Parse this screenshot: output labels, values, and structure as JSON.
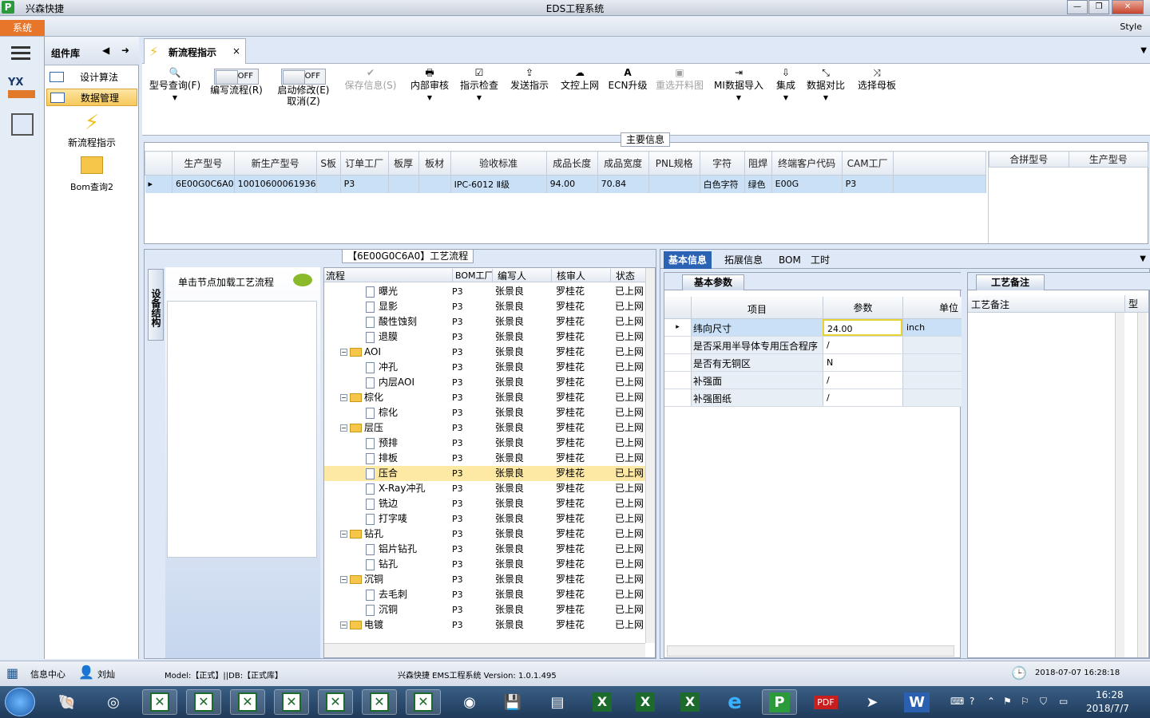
{
  "window": {
    "app_name": "兴森快捷",
    "title": "EDS工程系统",
    "style_label": "Style",
    "system_button": "系统"
  },
  "side_panel": {
    "header": "组件库",
    "items": [
      {
        "label": "设计算法",
        "selected": false
      },
      {
        "label": "数据管理",
        "selected": true
      }
    ],
    "launchers": [
      {
        "label": "新流程指示",
        "icon": "lightning-icon"
      },
      {
        "label": "Bom查询2",
        "icon": "folder-open-icon"
      }
    ]
  },
  "doc_tab": {
    "label": "新流程指示",
    "close": "×"
  },
  "toolbar": {
    "buttons": [
      {
        "label": "型号查询(F)",
        "icon": "search-icon",
        "enabled": true,
        "dropdown": true
      },
      {
        "label": "编写流程(R)",
        "toggle": "OFF",
        "enabled": true
      },
      {
        "label": "启动修改(E)",
        "label2": "取消(Z)",
        "toggle": "OFF",
        "enabled": true
      },
      {
        "label": "保存信息(S)",
        "icon": "check-icon",
        "enabled": false
      },
      {
        "label": "内部审核",
        "icon": "printer-icon",
        "enabled": true,
        "dropdown": true
      },
      {
        "label": "指示检查",
        "icon": "checkbox-icon",
        "enabled": true,
        "dropdown": true
      },
      {
        "label": "发送指示",
        "icon": "upload-icon",
        "enabled": true
      },
      {
        "label": "文控上网",
        "icon": "cloud-upload-icon",
        "enabled": true
      },
      {
        "label": "ECN升级",
        "icon": "text-a-icon",
        "enabled": true
      },
      {
        "label": "重选开料图",
        "icon": "image-icon",
        "enabled": false
      },
      {
        "label": "MI数据导入",
        "icon": "import-icon",
        "enabled": true,
        "dropdown": true
      },
      {
        "label": "集成",
        "icon": "download-icon",
        "enabled": true,
        "dropdown": true
      },
      {
        "label": "数据对比",
        "icon": "compare-icon",
        "enabled": true,
        "dropdown": true
      },
      {
        "label": "选择母板",
        "icon": "shuffle-icon",
        "enabled": true
      }
    ]
  },
  "main_info": {
    "title": "主要信息",
    "columns": [
      "生产型号",
      "新生产型号",
      "S板",
      "订单工厂",
      "板厚",
      "板材",
      "验收标准",
      "成品长度",
      "成品宽度",
      "PNL规格",
      "字符",
      "阻焊",
      "终端客户代码",
      "CAM工厂"
    ],
    "row": [
      "6E00G0C6A0",
      "10010600061936",
      "",
      "P3",
      "",
      "",
      "IPC-6012 Ⅱ级",
      "94.00",
      "70.84",
      "",
      "白色字符",
      "绿色",
      "E00G",
      "P3"
    ],
    "side_columns": [
      "合拼型号",
      "生产型号"
    ]
  },
  "process_flow": {
    "title": "【6E00G0C6A0】工艺流程",
    "left_tab": "设备结构",
    "hint": "单击节点加载工艺流程",
    "columns": [
      "流程",
      "BOM工厂",
      "编写人",
      "核审人",
      "状态"
    ],
    "rows": [
      {
        "label": "曝光",
        "level": 2,
        "type": "doc",
        "bom": "P3",
        "writer": "张景良",
        "reviewer": "罗桂花",
        "status": "已上网"
      },
      {
        "label": "显影",
        "level": 2,
        "type": "doc",
        "bom": "P3",
        "writer": "张景良",
        "reviewer": "罗桂花",
        "status": "已上网"
      },
      {
        "label": "酸性蚀刻",
        "level": 2,
        "type": "doc",
        "bom": "P3",
        "writer": "张景良",
        "reviewer": "罗桂花",
        "status": "已上网"
      },
      {
        "label": "退膜",
        "level": 2,
        "type": "doc",
        "bom": "P3",
        "writer": "张景良",
        "reviewer": "罗桂花",
        "status": "已上网"
      },
      {
        "label": "AOI",
        "level": 1,
        "type": "folder",
        "bom": "P3",
        "writer": "张景良",
        "reviewer": "罗桂花",
        "status": "已上网"
      },
      {
        "label": "冲孔",
        "level": 2,
        "type": "doc",
        "bom": "P3",
        "writer": "张景良",
        "reviewer": "罗桂花",
        "status": "已上网"
      },
      {
        "label": "内层AOI",
        "level": 2,
        "type": "doc",
        "bom": "P3",
        "writer": "张景良",
        "reviewer": "罗桂花",
        "status": "已上网"
      },
      {
        "label": "棕化",
        "level": 1,
        "type": "folder",
        "bom": "P3",
        "writer": "张景良",
        "reviewer": "罗桂花",
        "status": "已上网"
      },
      {
        "label": "棕化",
        "level": 2,
        "type": "doc",
        "bom": "P3",
        "writer": "张景良",
        "reviewer": "罗桂花",
        "status": "已上网"
      },
      {
        "label": "层压",
        "level": 1,
        "type": "folder",
        "bom": "P3",
        "writer": "张景良",
        "reviewer": "罗桂花",
        "status": "已上网"
      },
      {
        "label": "预排",
        "level": 2,
        "type": "doc",
        "bom": "P3",
        "writer": "张景良",
        "reviewer": "罗桂花",
        "status": "已上网"
      },
      {
        "label": "排板",
        "level": 2,
        "type": "doc",
        "bom": "P3",
        "writer": "张景良",
        "reviewer": "罗桂花",
        "status": "已上网"
      },
      {
        "label": "压合",
        "level": 2,
        "type": "doc",
        "bom": "P3",
        "writer": "张景良",
        "reviewer": "罗桂花",
        "status": "已上网",
        "selected": true
      },
      {
        "label": "X-Ray冲孔",
        "level": 2,
        "type": "doc",
        "bom": "P3",
        "writer": "张景良",
        "reviewer": "罗桂花",
        "status": "已上网"
      },
      {
        "label": "铣边",
        "level": 2,
        "type": "doc",
        "bom": "P3",
        "writer": "张景良",
        "reviewer": "罗桂花",
        "status": "已上网"
      },
      {
        "label": "打字唛",
        "level": 2,
        "type": "doc",
        "bom": "P3",
        "writer": "张景良",
        "reviewer": "罗桂花",
        "status": "已上网"
      },
      {
        "label": "钻孔",
        "level": 1,
        "type": "folder",
        "bom": "P3",
        "writer": "张景良",
        "reviewer": "罗桂花",
        "status": "已上网"
      },
      {
        "label": "铝片钻孔",
        "level": 2,
        "type": "doc",
        "bom": "P3",
        "writer": "张景良",
        "reviewer": "罗桂花",
        "status": "已上网"
      },
      {
        "label": "钻孔",
        "level": 2,
        "type": "doc",
        "bom": "P3",
        "writer": "张景良",
        "reviewer": "罗桂花",
        "status": "已上网"
      },
      {
        "label": "沉铜",
        "level": 1,
        "type": "folder",
        "bom": "P3",
        "writer": "张景良",
        "reviewer": "罗桂花",
        "status": "已上网"
      },
      {
        "label": "去毛刺",
        "level": 2,
        "type": "doc",
        "bom": "P3",
        "writer": "张景良",
        "reviewer": "罗桂花",
        "status": "已上网"
      },
      {
        "label": "沉铜",
        "level": 2,
        "type": "doc",
        "bom": "P3",
        "writer": "张景良",
        "reviewer": "罗桂花",
        "status": "已上网"
      },
      {
        "label": "电镀",
        "level": 1,
        "type": "folder",
        "bom": "P3",
        "writer": "张景良",
        "reviewer": "罗桂花",
        "status": "已上网"
      }
    ]
  },
  "detail_tabs": [
    "基本信息",
    "拓展信息",
    "BOM",
    "工时"
  ],
  "basic_params": {
    "title": "基本参数",
    "columns": [
      "项目",
      "参数",
      "单位"
    ],
    "rows": [
      {
        "item": "纬向尺寸",
        "value": "24.00",
        "unit": "inch"
      },
      {
        "item": "是否采用半导体专用压合程序",
        "value": "/",
        "unit": ""
      },
      {
        "item": "是否有无铜区",
        "value": "N",
        "unit": ""
      },
      {
        "item": "补强面",
        "value": "/",
        "unit": ""
      },
      {
        "item": "补强图纸",
        "value": "/",
        "unit": ""
      }
    ]
  },
  "process_notes": {
    "title": "工艺备注",
    "columns": [
      "工艺备注",
      "型"
    ]
  },
  "status_bar": {
    "info_center": "信息中心",
    "user": "刘灿",
    "model_db": "Model:【正式】||DB:【正式库】",
    "version": "兴森快捷 EMS工程系统 Version: 1.0.1.495",
    "datetime": "2018-07-07 16:28:18"
  },
  "taskbar": {
    "time": "16:28",
    "date": "2018/7/7"
  }
}
